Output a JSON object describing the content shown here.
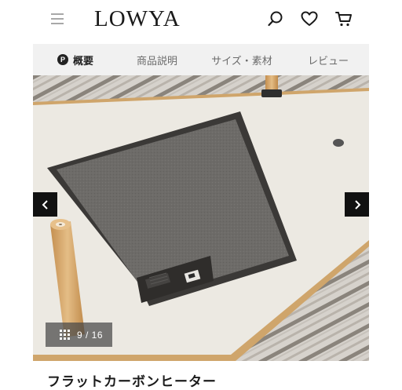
{
  "header": {
    "logo": "LOWYA",
    "icons": [
      "menu-icon",
      "search-icon",
      "heart-icon",
      "cart-icon"
    ]
  },
  "nav": {
    "badge": "P",
    "tabs": [
      {
        "label": "概要",
        "active": true
      },
      {
        "label": "商品説明",
        "active": false
      },
      {
        "label": "サイズ・素材",
        "active": false
      },
      {
        "label": "レビュー",
        "active": false
      }
    ]
  },
  "gallery": {
    "current": "9",
    "total": "16",
    "counter": "9 / 16"
  },
  "product": {
    "title": "フラットカーボンヒーター"
  },
  "colors": {
    "heater_body": "#3b3937",
    "heater_panel": "#6f6d6a",
    "tabletop": "#ece9e2",
    "wood": "#d9ac6f",
    "nav_bg": "#f1f1f1"
  }
}
